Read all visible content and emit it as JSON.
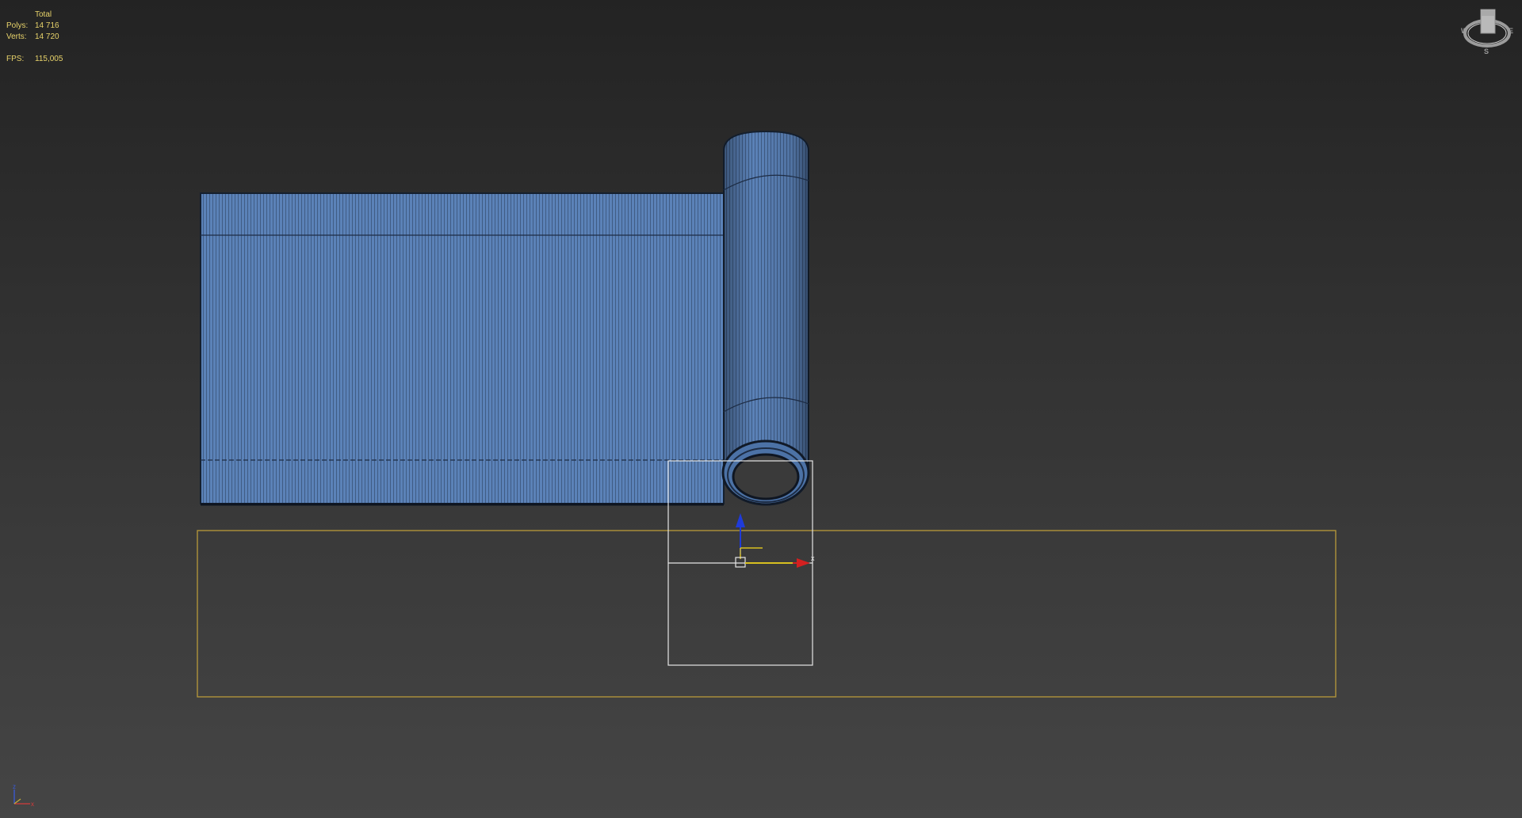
{
  "stats": {
    "header": "Total",
    "polys_label": "Polys:",
    "polys_value": "14 716",
    "verts_label": "Verts:",
    "verts_value": "14 720",
    "fps_label": "FPS:",
    "fps_value": "115,005"
  },
  "viewcube": {
    "west": "W",
    "east": "E",
    "south": "S"
  },
  "axis_tripod": {
    "z_label": "z",
    "x_label": "x"
  },
  "gizmo": {
    "x_label": "x"
  },
  "colors": {
    "background_top": "#232323",
    "background_bottom": "#454545",
    "mesh_fill": "#5b82b8",
    "mesh_wire": "#1d2c44",
    "stats_text": "#e8d36a",
    "selection_box": "#b89a3a",
    "gizmo_z": "#1f3bd9",
    "gizmo_x": "#d42020",
    "gizmo_y": "#d8c020"
  },
  "icons": {
    "viewcube": "viewcube-compass-icon",
    "axis_tripod": "world-axis-tripod-icon",
    "gizmo": "move-gizmo-icon"
  }
}
